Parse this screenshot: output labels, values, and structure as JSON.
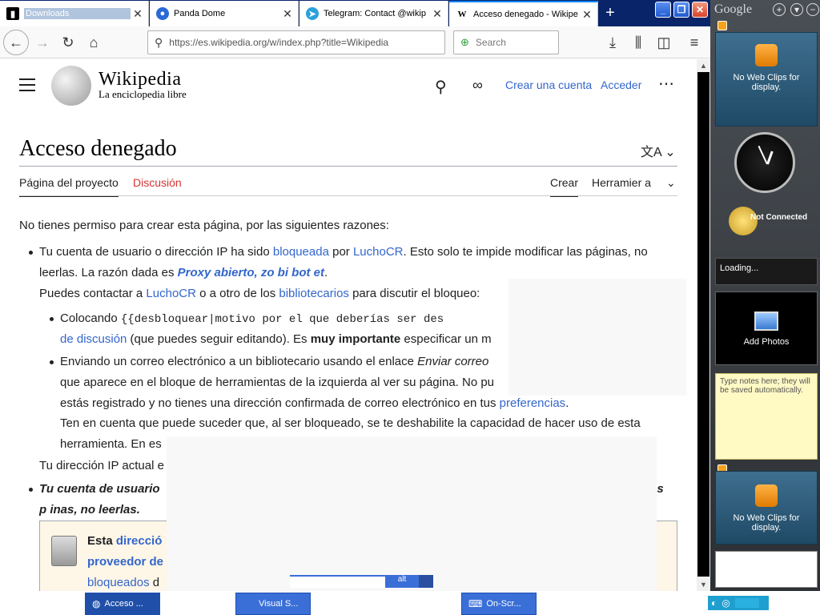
{
  "browser": {
    "tabs": [
      {
        "label": "Downloads",
        "icon": "downloads-icon"
      },
      {
        "label": "Panda Dome",
        "icon": "panda-icon"
      },
      {
        "label": "Telegram: Contact @wikip",
        "icon": "telegram-icon"
      },
      {
        "label": "Acceso denegado - Wikipe",
        "icon": "wikipedia-icon"
      }
    ],
    "url": "https://es.wikipedia.org/w/index.php?title=Wikipedia",
    "search_placeholder": "Search"
  },
  "wiki": {
    "brand": "Wikipedia",
    "tagline": "La enciclopedia libre",
    "create_account": "Crear una cuenta",
    "login": "Acceder",
    "page_title": "Acceso denegado",
    "tabs": {
      "project": "Página del proyecto",
      "discussion": "Discusión",
      "create": "Crear",
      "tools": "Herramier a"
    },
    "intro": "No tienes permiso para crear esta página, por las siguientes razones:",
    "b1": {
      "t1": "Tu cuenta de usuario o dirección IP ha sido ",
      "l1": "bloqueada",
      "t2": " por ",
      "l2": "LuchoCR",
      "t3": ". Esto solo te impide modificar las páginas, no",
      "t4": "leerlas. La razón dada es ",
      "reason": "Proxy abierto, zo  bi  bot  et",
      "t5": "Puedes contactar a ",
      "l3": "LuchoCR",
      "t6": " o a otro de los ",
      "l4": "bibliotecarios",
      "t7": " para discutir el bloqueo:"
    },
    "s1": {
      "t1": "Colocando ",
      "code": "{{desbloquear|motivo por el que deberías ser des",
      "l1": "de discusión",
      "t2": " (que puedes seguir editando). Es ",
      "bold": "muy importante",
      "t3": " especificar un m"
    },
    "s2": {
      "t1": "Enviando un correo electrónico a un bibliotecario usando el enlace ",
      "em": "Enviar correo",
      "t2": "que aparece en el bloque de herramientas de la izquierda al ver su página. No pu",
      "t3": "estás registrado y no tienes una dirección confirmada de correo electrónico en tus ",
      "l1": "preferencias",
      "t4": "Ten en cuenta que puede suceder que, al ser bloqueado, se te deshabilite la capacidad de hacer uso de esta",
      "t5": "herramienta. En es"
    },
    "ip_line": "Tu dirección IP actual e",
    "b2": {
      "t1": "Tu cuenta de usuario",
      "t2": "as",
      "t3": "p    inas, no leerlas."
    },
    "box": {
      "t1": "Esta ",
      "l1": "direcció",
      "l2": "proveedor de",
      "l3": "bloqueados",
      "t2": " d"
    }
  },
  "gadgets": {
    "brand": "Google",
    "webclip": "No Web Clips for display.",
    "clock_status": "Not Connected",
    "loading": "Loading...",
    "photos": "Add Photos",
    "notes": "Type notes here; they will be saved automatically."
  },
  "taskbar": {
    "items": [
      "Acceso ...",
      "Visual S...",
      "On-Scr..."
    ],
    "partial": "alt"
  }
}
